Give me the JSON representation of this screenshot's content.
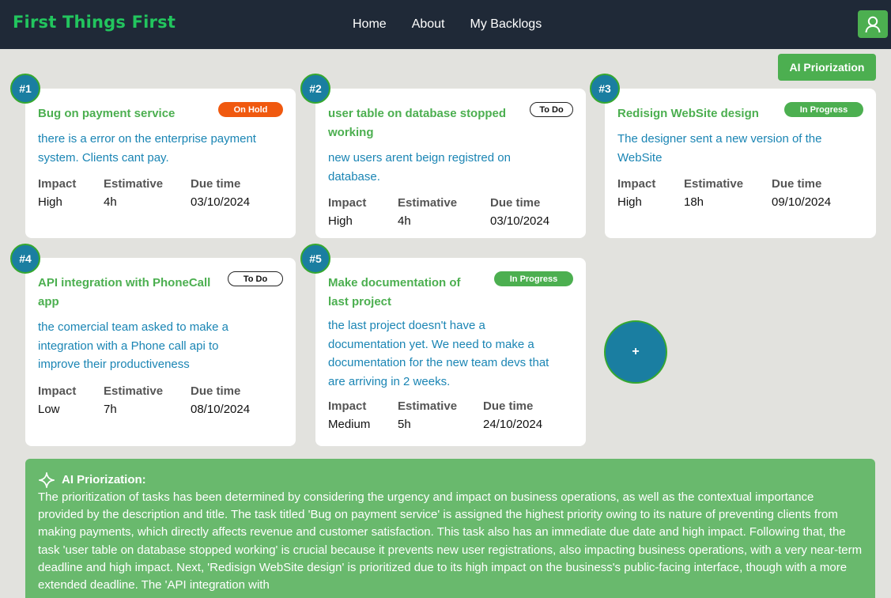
{
  "brand": "First Things First",
  "nav": {
    "links": [
      "Home",
      "About",
      "My Backlogs"
    ]
  },
  "user_icon": "user-icon",
  "ai_button": "AI Priorization",
  "tasks": [
    {
      "num": "#1",
      "title": "Bug on payment service",
      "status": "On Hold",
      "description": "there is a error on the enterprise payment system. Clients cant pay.",
      "impact_label": "Impact",
      "estimative_label": "Estimative",
      "due_label": "Due time",
      "impact": "High",
      "estimative": "4h",
      "due": "03/10/2024"
    },
    {
      "num": "#2",
      "title": "user table on database stopped working",
      "status": "To Do",
      "description": "new users arent beign registred on database.",
      "impact_label": "Impact",
      "estimative_label": "Estimative",
      "due_label": "Due time",
      "impact": "High",
      "estimative": "4h",
      "due": "03/10/2024"
    },
    {
      "num": "#3",
      "title": "Redisign WebSite design",
      "status": "In Progress",
      "description": "The designer sent a new version of the WebSite",
      "impact_label": "Impact",
      "estimative_label": "Estimative",
      "due_label": "Due time",
      "impact": "High",
      "estimative": "18h",
      "due": "09/10/2024"
    },
    {
      "num": "#4",
      "title": "API integration with PhoneCall app",
      "status": "To Do",
      "description": "the comercial team asked to make a integration with a Phone call api to improve their productiveness",
      "impact_label": "Impact",
      "estimative_label": "Estimative",
      "due_label": "Due time",
      "impact": "Low",
      "estimative": "7h",
      "due": "08/10/2024"
    },
    {
      "num": "#5",
      "title": "Make documentation of last project",
      "status": "In Progress",
      "description": "the last project doesn't have a documentation yet. We need to make a documentation for the new team devs that are arriving in 2 weeks.",
      "impact_label": "Impact",
      "estimative_label": "Estimative",
      "due_label": "Due time",
      "impact": "Medium",
      "estimative": "5h",
      "due": "24/10/2024"
    }
  ],
  "add_button": "+",
  "ai_panel": {
    "heading": "AI Priorization:",
    "icon": "sparkle-icon",
    "text": "The prioritization of tasks has been determined by considering the urgency and impact on business operations, as well as the contextual importance provided by the description and title. The task titled 'Bug on payment service' is assigned the highest priority owing to its nature of preventing clients from making payments, which directly affects revenue and customer satisfaction. This task also has an immediate due date and high impact. Following that, the task 'user table on database stopped working' is crucial because it prevents new user registrations, also impacting business operations, with a very near-term deadline and high impact. Next, 'Redisign WebSite design' is prioritized due to its high impact on the business's public-facing interface, though with a more extended deadline. The 'API integration with"
  },
  "colors": {
    "navbar": "#1f2937",
    "brand": "#22c55e",
    "accent_green": "#4caf50",
    "circle_blue": "#1a7ea1",
    "on_hold": "#f0590f",
    "description_blue": "#1a85b4",
    "panel_green": "#69b96d"
  }
}
